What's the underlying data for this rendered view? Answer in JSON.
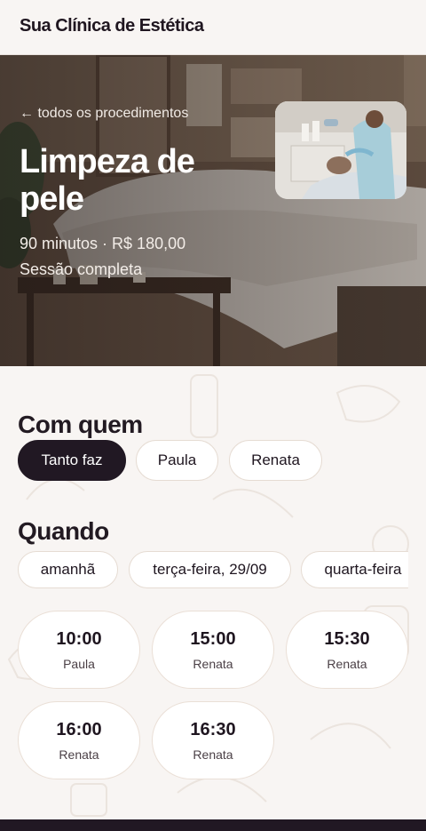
{
  "header": {
    "brand": "Sua Clínica de Estética"
  },
  "hero": {
    "back_link": "← todos os procedimentos",
    "title": "Limpeza de pele",
    "duration_price": "90 minutos · R$ 180,00",
    "session_type": "Sessão completa"
  },
  "professionals": {
    "title": "Com quem",
    "options": [
      "Tanto faz",
      "Paula",
      "Renata"
    ],
    "selected": "Tanto faz"
  },
  "schedule": {
    "title": "Quando",
    "days": [
      "amanhã",
      "terça-feira, 29/09",
      "quarta-feira"
    ],
    "slots": [
      {
        "time": "10:00",
        "professional": "Paula"
      },
      {
        "time": "15:00",
        "professional": "Renata"
      },
      {
        "time": "15:30",
        "professional": "Renata"
      },
      {
        "time": "16:00",
        "professional": "Renata"
      },
      {
        "time": "16:30",
        "professional": "Renata"
      }
    ]
  },
  "colors": {
    "accent_dark": "#211823",
    "background": "#f8f5f3",
    "pill_border": "#e6dcd3"
  }
}
